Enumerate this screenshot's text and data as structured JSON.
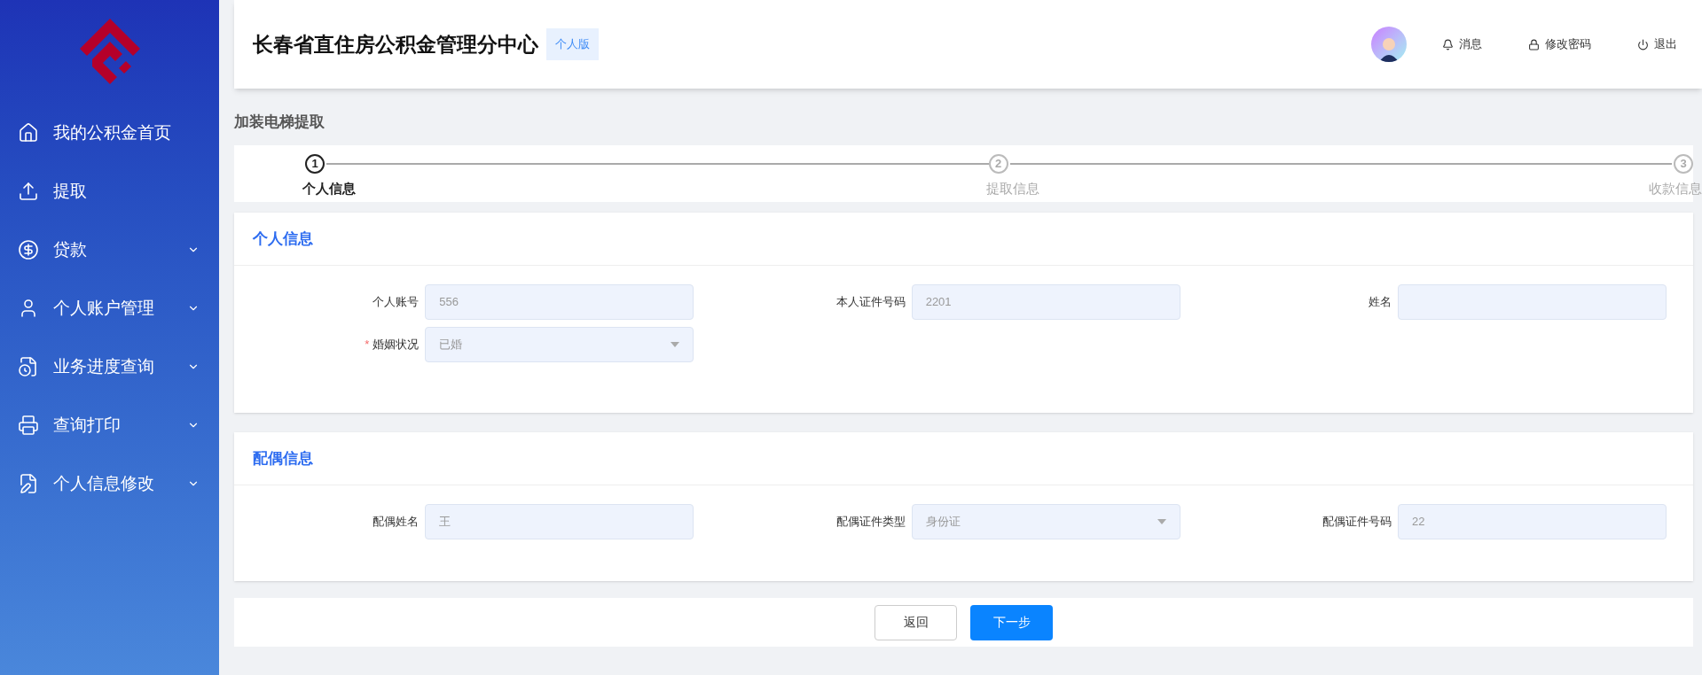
{
  "header": {
    "title": "长春省直住房公积金管理分中心",
    "badge": "个人版",
    "actions": [
      {
        "kind": "bell",
        "label": "消息"
      },
      {
        "kind": "lock",
        "label": "修改密码"
      },
      {
        "kind": "power",
        "label": "退出"
      }
    ]
  },
  "sidebar": {
    "items": [
      {
        "label": "我的公积金首页",
        "expandable": false
      },
      {
        "label": "提取",
        "expandable": false
      },
      {
        "label": "贷款",
        "expandable": true
      },
      {
        "label": "个人账户管理",
        "expandable": true
      },
      {
        "label": "业务进度查询",
        "expandable": true
      },
      {
        "label": "查询打印",
        "expandable": true
      },
      {
        "label": "个人信息修改",
        "expandable": true
      }
    ]
  },
  "page_title": "加装电梯提取",
  "steps": [
    {
      "number": "1",
      "label": "个人信息",
      "selected": true
    },
    {
      "number": "2",
      "label": "提取信息",
      "selected": false
    },
    {
      "number": "3",
      "label": "收款信息",
      "selected": false
    }
  ],
  "sections": [
    {
      "title": "个人信息",
      "fields": [
        {
          "label": "个人账号",
          "kind": "text",
          "value": "556",
          "required": false
        },
        {
          "label": "本人证件号码",
          "kind": "text",
          "value": "2201",
          "required": false
        },
        {
          "label": "姓名",
          "kind": "text",
          "required": false
        },
        {
          "label": "婚姻状况",
          "kind": "select",
          "value": "已婚",
          "required": true,
          "required_mark": "*"
        }
      ]
    },
    {
      "title": "配偶信息",
      "fields": [
        {
          "label": "配偶姓名",
          "kind": "text",
          "value": "王",
          "required": false
        },
        {
          "label": "配偶证件类型",
          "kind": "select",
          "value": "身份证",
          "required": false
        },
        {
          "label": "配偶证件号码",
          "kind": "text",
          "value": "22",
          "required": false
        }
      ]
    }
  ],
  "buttons": [
    {
      "label": "返回",
      "kind": "secondary"
    },
    {
      "label": "下一步",
      "kind": "primary"
    }
  ]
}
